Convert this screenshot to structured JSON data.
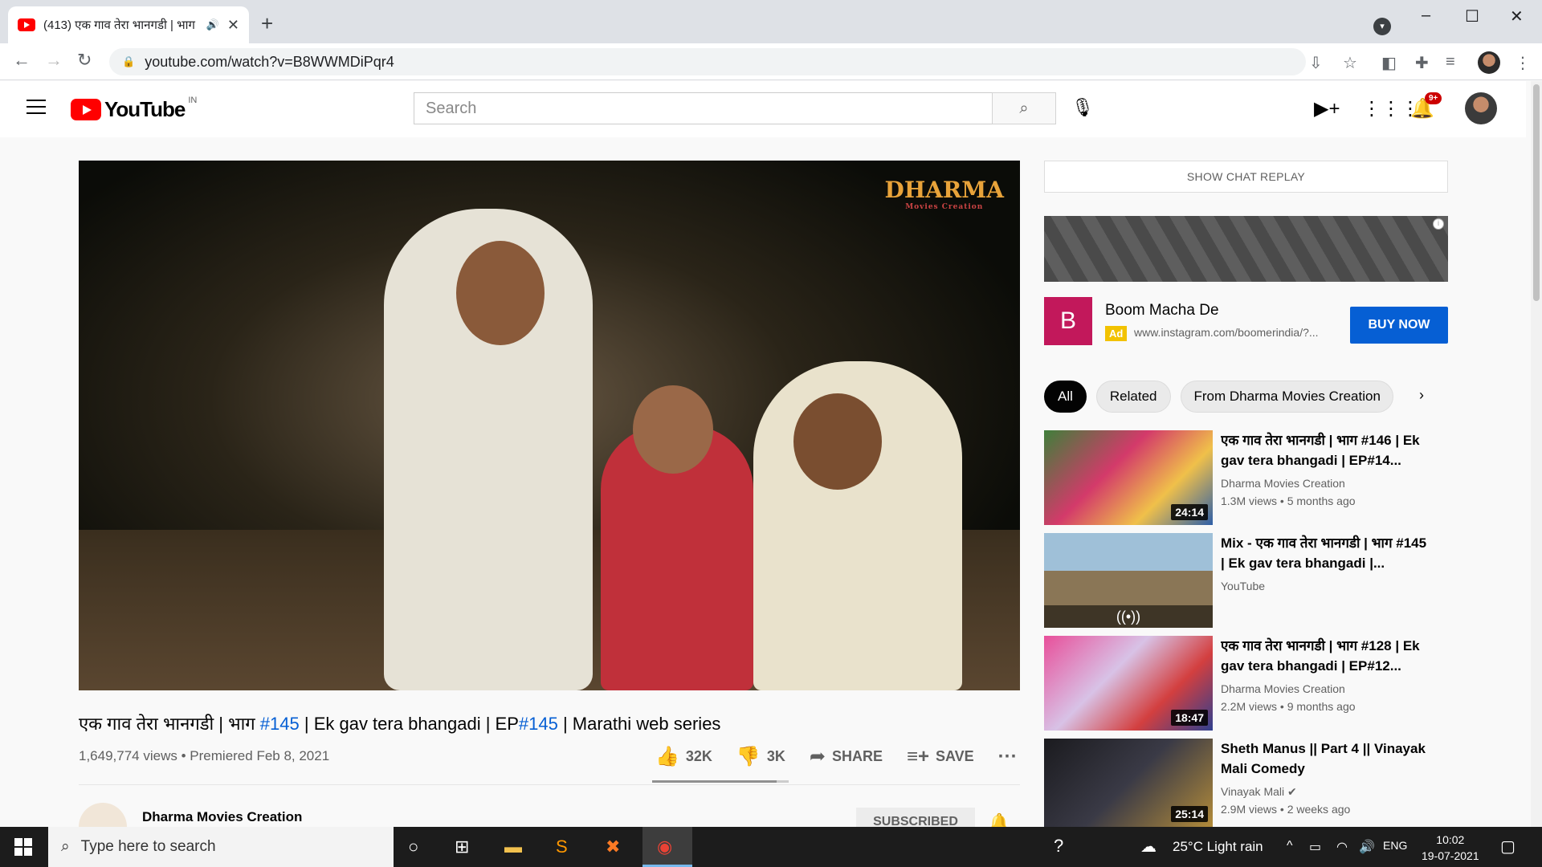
{
  "browser": {
    "tab_title": "(413) एक गाव तेरा भानगडी | भाग",
    "url": "youtube.com/watch?v=B8WWMDiPqr4"
  },
  "youtube": {
    "logo_text": "YouTube",
    "country": "IN",
    "search_placeholder": "Search",
    "notif_badge": "9+"
  },
  "player": {
    "watermark": "DHARMA",
    "watermark_sub": "Movies Creation"
  },
  "video": {
    "title_part1": "एक गाव तेरा भानगडी | भाग ",
    "title_tag1": "#145",
    "title_part2": " | Ek gav tera bhangadi | EP",
    "title_tag2": "#145",
    "title_part3": " | Marathi web series",
    "views": "1,649,774 views",
    "premiered": "Premiered Feb 8, 2021",
    "likes": "32K",
    "dislikes": "3K",
    "like_ratio": 0.91,
    "share": "SHARE",
    "save": "SAVE",
    "channel": "Dharma Movies Creation",
    "subscribed": "SUBSCRIBED"
  },
  "sidebar": {
    "chat_replay": "SHOW CHAT REPLAY",
    "ad": {
      "badge": "B",
      "title": "Boom Macha De",
      "label": "Ad",
      "url": "www.instagram.com/boomerindia/?...",
      "cta": "BUY NOW"
    },
    "chips": [
      "All",
      "Related",
      "From Dharma Movies Creation"
    ],
    "recommendations": [
      {
        "title": "एक गाव तेरा भानगडी | भाग #146 | Ek gav tera bhangadi | EP#14...",
        "channel": "Dharma Movies Creation",
        "stats": "1.3M views • 5 months ago",
        "duration": "24:14"
      },
      {
        "title": "Mix - एक गाव तेरा भानगडी | भाग #145 | Ek gav tera bhangadi |...",
        "channel": "YouTube",
        "stats": "",
        "duration": ""
      },
      {
        "title": "एक गाव तेरा भानगडी | भाग #128 | Ek gav tera bhangadi | EP#12...",
        "channel": "Dharma Movies Creation",
        "stats": "2.2M views • 9 months ago",
        "duration": "18:47"
      },
      {
        "title": "Sheth Manus || Part 4 || Vinayak Mali Comedy",
        "channel": "Vinayak Mali",
        "stats": "2.9M views • 2 weeks ago",
        "duration": "25:14"
      }
    ]
  },
  "taskbar": {
    "search_placeholder": "Type here to search",
    "weather": "25°C  Light rain",
    "lang": "ENG",
    "time": "10:02",
    "date": "19-07-2021"
  }
}
